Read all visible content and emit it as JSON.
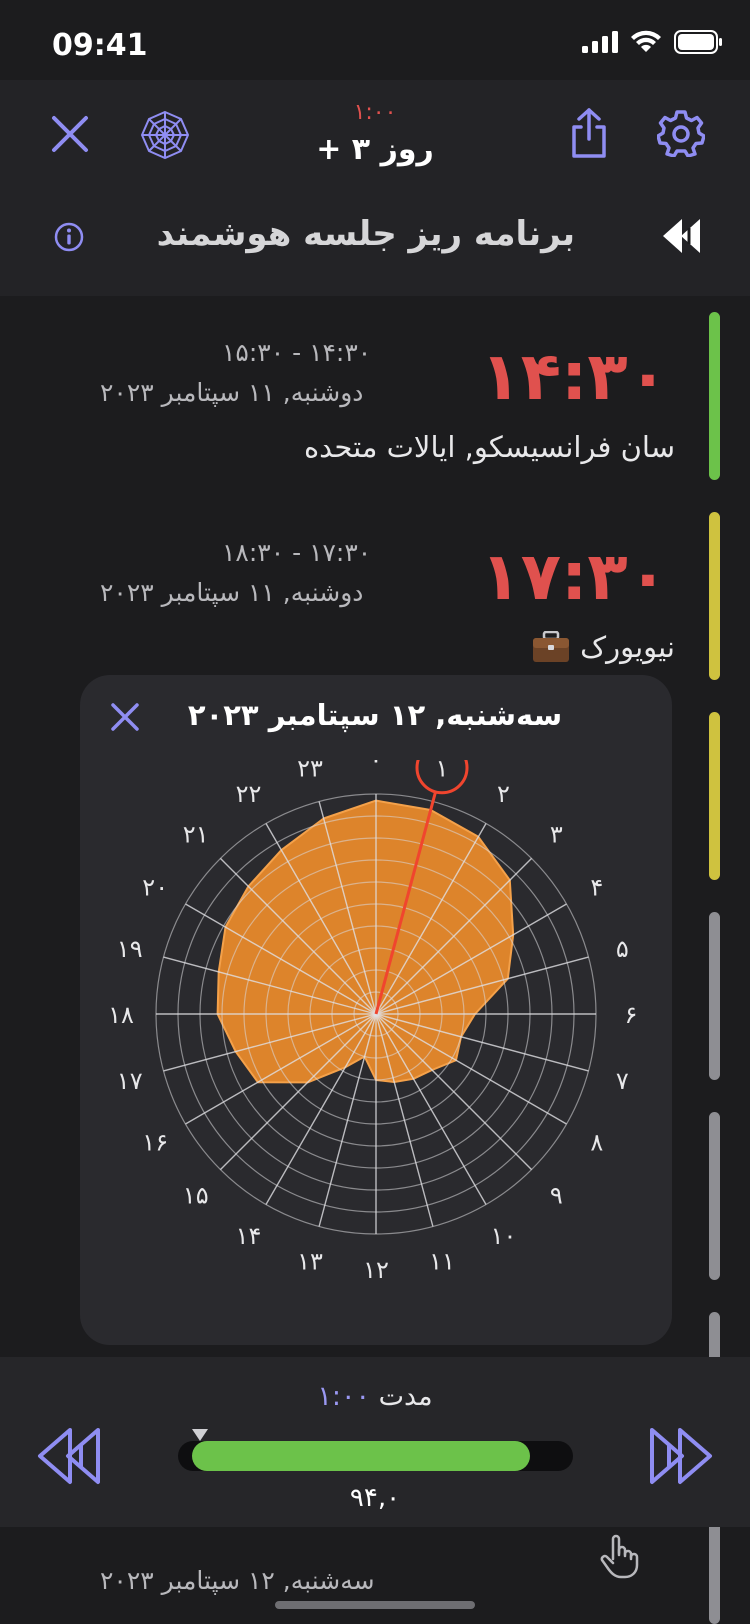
{
  "status_bar": {
    "time": "09:41"
  },
  "header": {
    "small_time": "۱:۰۰",
    "days_label": "+ ۳ روز",
    "page_title": "برنامه ریز جلسه هوشمند"
  },
  "icons": {
    "close": "close-icon",
    "web": "spider-web-icon",
    "share": "share-icon",
    "settings": "gear-icon",
    "info": "info-icon",
    "skip_back": "skip-back-icon",
    "briefcase": "briefcase-icon",
    "hand": "hand-pointer-icon"
  },
  "entries": [
    {
      "time": "۱۴:۳۰",
      "range": "۱۴:۳۰ - ۱۵:۳۰",
      "date": "دوشنبه, ۱۱ سپتامبر ۲۰۲۳",
      "place": "سان فرانسیسکو, ایالات متحده",
      "bar_color": "#6cc24a"
    },
    {
      "time": "۱۷:۳۰",
      "range": "۱۷:۳۰ - ۱۸:۳۰",
      "date": "دوشنبه, ۱۱ سپتامبر ۲۰۲۳",
      "place": "نیویورک",
      "bar_color": "#cfc23f"
    }
  ],
  "side_bars": [
    "#cfc23f",
    "#8e8e93",
    "#8e8e93",
    "#8e8e93"
  ],
  "popup": {
    "title": "سه‌شنبه, ۱۲ سپتامبر ۲۰۲۳",
    "hour_labels": [
      "۰",
      "۱",
      "۲",
      "۳",
      "۴",
      "۵",
      "۶",
      "۷",
      "۸",
      "۹",
      "۱۰",
      "۱۱",
      "۱۲",
      "۱۳",
      "۱۴",
      "۱۵",
      "۱۶",
      "۱۷",
      "۱۸",
      "۱۹",
      "۲۰",
      "۲۱",
      "۲۲",
      "۲۳"
    ],
    "selected_hour": 1,
    "fill_color": "#ed8c2b",
    "needle_color": "#f0452e",
    "profile": [
      0.97,
      0.96,
      0.93,
      0.86,
      0.72,
      0.62,
      0.45,
      0.4,
      0.42,
      0.36,
      0.34,
      0.32,
      0.3,
      0.2,
      0.28,
      0.44,
      0.62,
      0.66,
      0.72,
      0.74,
      0.79,
      0.82,
      0.86,
      0.92
    ]
  },
  "bottom": {
    "duration_label": "مدت",
    "duration_value": "۱:۰۰",
    "slider_value_text": "۹۴,۰",
    "slider_fraction": 0.94,
    "bottom_date": "سه‌شنبه, ۱۲ سپتامبر ۲۰۲۳"
  },
  "colors": {
    "accent": "#8f8df2",
    "time_red": "#e0514e",
    "slider_green": "#6cc24a"
  }
}
